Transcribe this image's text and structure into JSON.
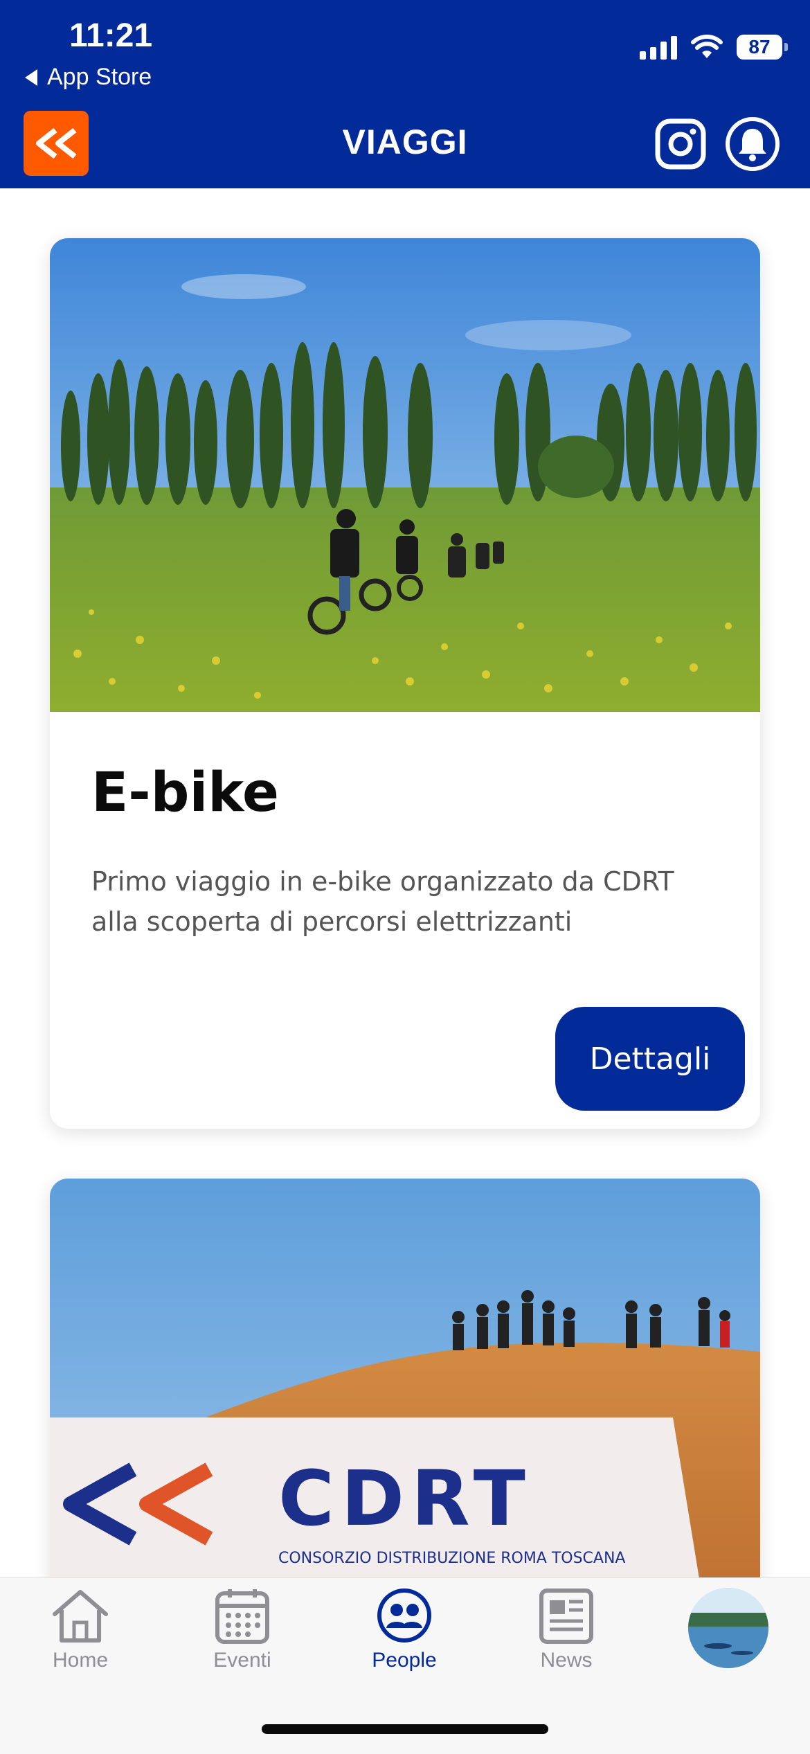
{
  "status_bar": {
    "time": "11:21",
    "back_label": "App Store",
    "battery": "87"
  },
  "header": {
    "title": "VIAGGI",
    "background_color": "#032a99",
    "logo_color": "#ff5a00"
  },
  "cards": [
    {
      "title": "E-bike",
      "description": "Primo viaggio in e-bike organizzato da CDRT alla scoperta di percorsi elettrizzanti",
      "button_label": "Dettagli",
      "image": "cyclists-in-field-photo"
    },
    {
      "image": "group-on-sand-dune-photo",
      "banner_brand": "CDRT",
      "banner_subtitle": "CONSORZIO DISTRIBUZIONE ROMA TOSCANA"
    }
  ],
  "tabbar": {
    "items": [
      {
        "label": "Home",
        "icon": "home-icon",
        "active": false
      },
      {
        "label": "Eventi",
        "icon": "calendar-icon",
        "active": false
      },
      {
        "label": "People",
        "icon": "people-icon",
        "active": true
      },
      {
        "label": "News",
        "icon": "newspaper-icon",
        "active": false
      },
      {
        "label": "",
        "icon": "profile-avatar",
        "active": false
      }
    ]
  },
  "colors": {
    "primary": "#032a99",
    "accent": "#ff5a00",
    "tab_inactive": "#8e8e93"
  }
}
